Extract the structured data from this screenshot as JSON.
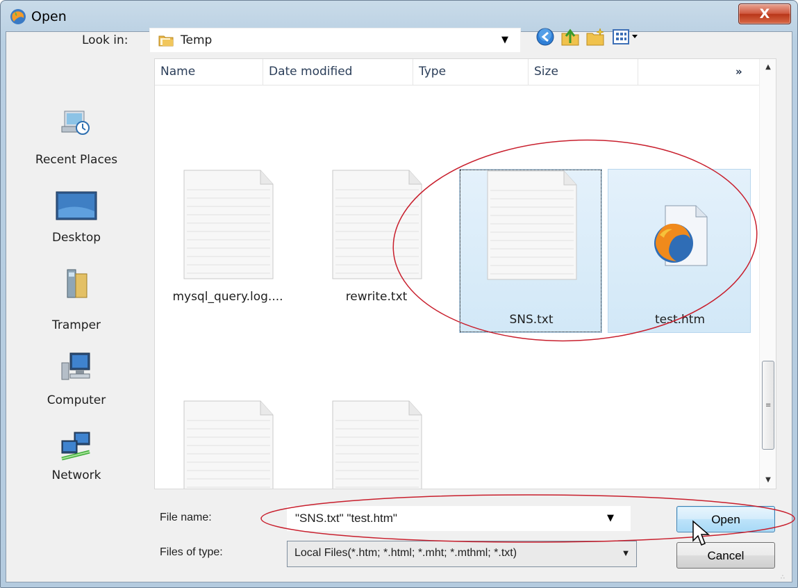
{
  "window": {
    "title": "Open",
    "close_label": "X"
  },
  "toolbar": {
    "lookin_label": "Look in:",
    "lookin_value": "Temp",
    "icons": [
      "back-icon",
      "up-folder-icon",
      "new-folder-icon",
      "views-menu-icon"
    ]
  },
  "places": [
    {
      "label": "Recent Places",
      "icon": "recent-places-icon"
    },
    {
      "label": "Desktop",
      "icon": "desktop-icon"
    },
    {
      "label": "Tramper",
      "icon": "user-folder-icon"
    },
    {
      "label": "Computer",
      "icon": "computer-icon"
    },
    {
      "label": "Network",
      "icon": "network-icon"
    }
  ],
  "columns": [
    "Name",
    "Date modified",
    "Type",
    "Size"
  ],
  "columns_more": "»",
  "files": [
    {
      "name": "mysql_query.log....",
      "icon": "text-file-icon",
      "selected": false
    },
    {
      "name": "rewrite.txt",
      "icon": "text-file-icon",
      "selected": false
    },
    {
      "name": "SNS.txt",
      "icon": "text-file-icon",
      "selected": true
    },
    {
      "name": "test.htm",
      "icon": "firefox-document-icon",
      "selected": true
    },
    {
      "name": "",
      "icon": "text-file-icon",
      "selected": false
    },
    {
      "name": "",
      "icon": "text-file-icon",
      "selected": false
    }
  ],
  "form": {
    "file_name_label": "File name:",
    "file_name_value": "\"SNS.txt\" \"test.htm\"",
    "file_type_label": "Files of type:",
    "file_type_value": "Local Files(*.htm; *.html; *.mht; *.mthml; *.txt)"
  },
  "buttons": {
    "open": "Open",
    "cancel": "Cancel"
  },
  "colors": {
    "annotation": "#c81e2c",
    "selection": "#d9ecf9"
  }
}
